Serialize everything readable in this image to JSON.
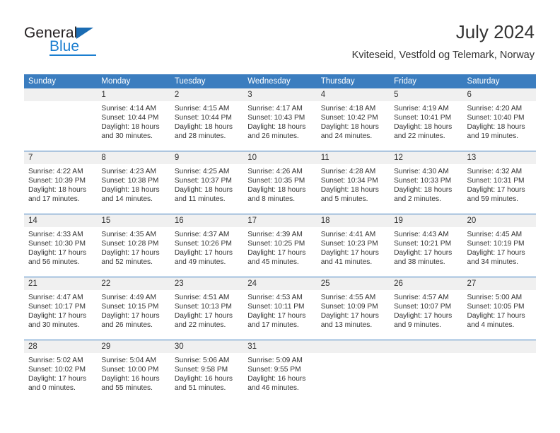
{
  "brand": {
    "name_part1": "General",
    "name_part2": "Blue"
  },
  "header": {
    "title": "July 2024",
    "subtitle": "Kviteseid, Vestfold og Telemark, Norway"
  },
  "colors": {
    "header_bar": "#3b7dbf",
    "day_strip": "#f0f0f0",
    "brand_blue": "#1b7ed0",
    "text": "#333333"
  },
  "weekday_headers": [
    "Sunday",
    "Monday",
    "Tuesday",
    "Wednesday",
    "Thursday",
    "Friday",
    "Saturday"
  ],
  "weeks": [
    [
      {
        "day": "",
        "sunrise": "",
        "sunset": "",
        "daylight_line1": "",
        "daylight_line2": ""
      },
      {
        "day": "1",
        "sunrise": "Sunrise: 4:14 AM",
        "sunset": "Sunset: 10:44 PM",
        "daylight_line1": "Daylight: 18 hours",
        "daylight_line2": "and 30 minutes."
      },
      {
        "day": "2",
        "sunrise": "Sunrise: 4:15 AM",
        "sunset": "Sunset: 10:44 PM",
        "daylight_line1": "Daylight: 18 hours",
        "daylight_line2": "and 28 minutes."
      },
      {
        "day": "3",
        "sunrise": "Sunrise: 4:17 AM",
        "sunset": "Sunset: 10:43 PM",
        "daylight_line1": "Daylight: 18 hours",
        "daylight_line2": "and 26 minutes."
      },
      {
        "day": "4",
        "sunrise": "Sunrise: 4:18 AM",
        "sunset": "Sunset: 10:42 PM",
        "daylight_line1": "Daylight: 18 hours",
        "daylight_line2": "and 24 minutes."
      },
      {
        "day": "5",
        "sunrise": "Sunrise: 4:19 AM",
        "sunset": "Sunset: 10:41 PM",
        "daylight_line1": "Daylight: 18 hours",
        "daylight_line2": "and 22 minutes."
      },
      {
        "day": "6",
        "sunrise": "Sunrise: 4:20 AM",
        "sunset": "Sunset: 10:40 PM",
        "daylight_line1": "Daylight: 18 hours",
        "daylight_line2": "and 19 minutes."
      }
    ],
    [
      {
        "day": "7",
        "sunrise": "Sunrise: 4:22 AM",
        "sunset": "Sunset: 10:39 PM",
        "daylight_line1": "Daylight: 18 hours",
        "daylight_line2": "and 17 minutes."
      },
      {
        "day": "8",
        "sunrise": "Sunrise: 4:23 AM",
        "sunset": "Sunset: 10:38 PM",
        "daylight_line1": "Daylight: 18 hours",
        "daylight_line2": "and 14 minutes."
      },
      {
        "day": "9",
        "sunrise": "Sunrise: 4:25 AM",
        "sunset": "Sunset: 10:37 PM",
        "daylight_line1": "Daylight: 18 hours",
        "daylight_line2": "and 11 minutes."
      },
      {
        "day": "10",
        "sunrise": "Sunrise: 4:26 AM",
        "sunset": "Sunset: 10:35 PM",
        "daylight_line1": "Daylight: 18 hours",
        "daylight_line2": "and 8 minutes."
      },
      {
        "day": "11",
        "sunrise": "Sunrise: 4:28 AM",
        "sunset": "Sunset: 10:34 PM",
        "daylight_line1": "Daylight: 18 hours",
        "daylight_line2": "and 5 minutes."
      },
      {
        "day": "12",
        "sunrise": "Sunrise: 4:30 AM",
        "sunset": "Sunset: 10:33 PM",
        "daylight_line1": "Daylight: 18 hours",
        "daylight_line2": "and 2 minutes."
      },
      {
        "day": "13",
        "sunrise": "Sunrise: 4:32 AM",
        "sunset": "Sunset: 10:31 PM",
        "daylight_line1": "Daylight: 17 hours",
        "daylight_line2": "and 59 minutes."
      }
    ],
    [
      {
        "day": "14",
        "sunrise": "Sunrise: 4:33 AM",
        "sunset": "Sunset: 10:30 PM",
        "daylight_line1": "Daylight: 17 hours",
        "daylight_line2": "and 56 minutes."
      },
      {
        "day": "15",
        "sunrise": "Sunrise: 4:35 AM",
        "sunset": "Sunset: 10:28 PM",
        "daylight_line1": "Daylight: 17 hours",
        "daylight_line2": "and 52 minutes."
      },
      {
        "day": "16",
        "sunrise": "Sunrise: 4:37 AM",
        "sunset": "Sunset: 10:26 PM",
        "daylight_line1": "Daylight: 17 hours",
        "daylight_line2": "and 49 minutes."
      },
      {
        "day": "17",
        "sunrise": "Sunrise: 4:39 AM",
        "sunset": "Sunset: 10:25 PM",
        "daylight_line1": "Daylight: 17 hours",
        "daylight_line2": "and 45 minutes."
      },
      {
        "day": "18",
        "sunrise": "Sunrise: 4:41 AM",
        "sunset": "Sunset: 10:23 PM",
        "daylight_line1": "Daylight: 17 hours",
        "daylight_line2": "and 41 minutes."
      },
      {
        "day": "19",
        "sunrise": "Sunrise: 4:43 AM",
        "sunset": "Sunset: 10:21 PM",
        "daylight_line1": "Daylight: 17 hours",
        "daylight_line2": "and 38 minutes."
      },
      {
        "day": "20",
        "sunrise": "Sunrise: 4:45 AM",
        "sunset": "Sunset: 10:19 PM",
        "daylight_line1": "Daylight: 17 hours",
        "daylight_line2": "and 34 minutes."
      }
    ],
    [
      {
        "day": "21",
        "sunrise": "Sunrise: 4:47 AM",
        "sunset": "Sunset: 10:17 PM",
        "daylight_line1": "Daylight: 17 hours",
        "daylight_line2": "and 30 minutes."
      },
      {
        "day": "22",
        "sunrise": "Sunrise: 4:49 AM",
        "sunset": "Sunset: 10:15 PM",
        "daylight_line1": "Daylight: 17 hours",
        "daylight_line2": "and 26 minutes."
      },
      {
        "day": "23",
        "sunrise": "Sunrise: 4:51 AM",
        "sunset": "Sunset: 10:13 PM",
        "daylight_line1": "Daylight: 17 hours",
        "daylight_line2": "and 22 minutes."
      },
      {
        "day": "24",
        "sunrise": "Sunrise: 4:53 AM",
        "sunset": "Sunset: 10:11 PM",
        "daylight_line1": "Daylight: 17 hours",
        "daylight_line2": "and 17 minutes."
      },
      {
        "day": "25",
        "sunrise": "Sunrise: 4:55 AM",
        "sunset": "Sunset: 10:09 PM",
        "daylight_line1": "Daylight: 17 hours",
        "daylight_line2": "and 13 minutes."
      },
      {
        "day": "26",
        "sunrise": "Sunrise: 4:57 AM",
        "sunset": "Sunset: 10:07 PM",
        "daylight_line1": "Daylight: 17 hours",
        "daylight_line2": "and 9 minutes."
      },
      {
        "day": "27",
        "sunrise": "Sunrise: 5:00 AM",
        "sunset": "Sunset: 10:05 PM",
        "daylight_line1": "Daylight: 17 hours",
        "daylight_line2": "and 4 minutes."
      }
    ],
    [
      {
        "day": "28",
        "sunrise": "Sunrise: 5:02 AM",
        "sunset": "Sunset: 10:02 PM",
        "daylight_line1": "Daylight: 17 hours",
        "daylight_line2": "and 0 minutes."
      },
      {
        "day": "29",
        "sunrise": "Sunrise: 5:04 AM",
        "sunset": "Sunset: 10:00 PM",
        "daylight_line1": "Daylight: 16 hours",
        "daylight_line2": "and 55 minutes."
      },
      {
        "day": "30",
        "sunrise": "Sunrise: 5:06 AM",
        "sunset": "Sunset: 9:58 PM",
        "daylight_line1": "Daylight: 16 hours",
        "daylight_line2": "and 51 minutes."
      },
      {
        "day": "31",
        "sunrise": "Sunrise: 5:09 AM",
        "sunset": "Sunset: 9:55 PM",
        "daylight_line1": "Daylight: 16 hours",
        "daylight_line2": "and 46 minutes."
      },
      {
        "day": "",
        "sunrise": "",
        "sunset": "",
        "daylight_line1": "",
        "daylight_line2": ""
      },
      {
        "day": "",
        "sunrise": "",
        "sunset": "",
        "daylight_line1": "",
        "daylight_line2": ""
      },
      {
        "day": "",
        "sunrise": "",
        "sunset": "",
        "daylight_line1": "",
        "daylight_line2": ""
      }
    ]
  ]
}
